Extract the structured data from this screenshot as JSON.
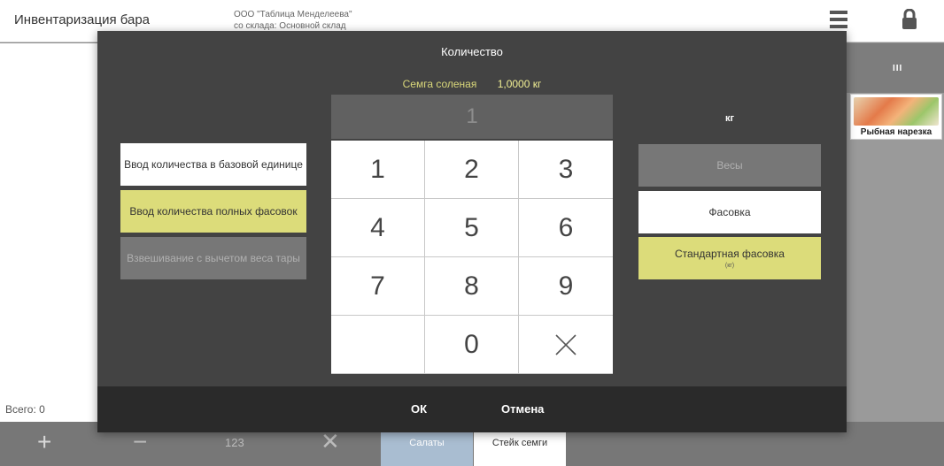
{
  "app": {
    "title": "Инвентаризация бара",
    "org": "ООО \"Таблица Менделеева\"",
    "store": "со склада: Основной склад",
    "menu_icon": "hamburger-menu-icon",
    "lock_icon": "lock-icon"
  },
  "left_panel": {
    "total": "Всего: 0"
  },
  "right_panel": {
    "grid_icon": "III",
    "tile_label": "Рыбная нарезка"
  },
  "bottom_bar": {
    "plus": "+",
    "minus": "−",
    "numeric": "123",
    "delete": "✕",
    "tabs": [
      "Салаты",
      "Стейк семги"
    ]
  },
  "modal": {
    "title": "Количество",
    "item_name": "Семга соленая",
    "item_qty": "1,0000 кг",
    "display_value": "1",
    "keys": [
      "1",
      "2",
      "3",
      "4",
      "5",
      "6",
      "7",
      "8",
      "9",
      "",
      "0"
    ],
    "left_options": [
      "Ввод количества в базовой единице",
      "Ввод количества полных фасовок",
      "Взвешивание с вычетом веса тары"
    ],
    "unit_label": "кг",
    "right_options": [
      "Весы",
      "Фасовка",
      "Стандартная фасовка"
    ],
    "right_option_sub": "(кг)",
    "ok_label": "ОК",
    "cancel_label": "Отмена",
    "colors": {
      "selected": "#dcdc7a",
      "disabled": "#777777",
      "modal_bg": "#434343"
    }
  }
}
